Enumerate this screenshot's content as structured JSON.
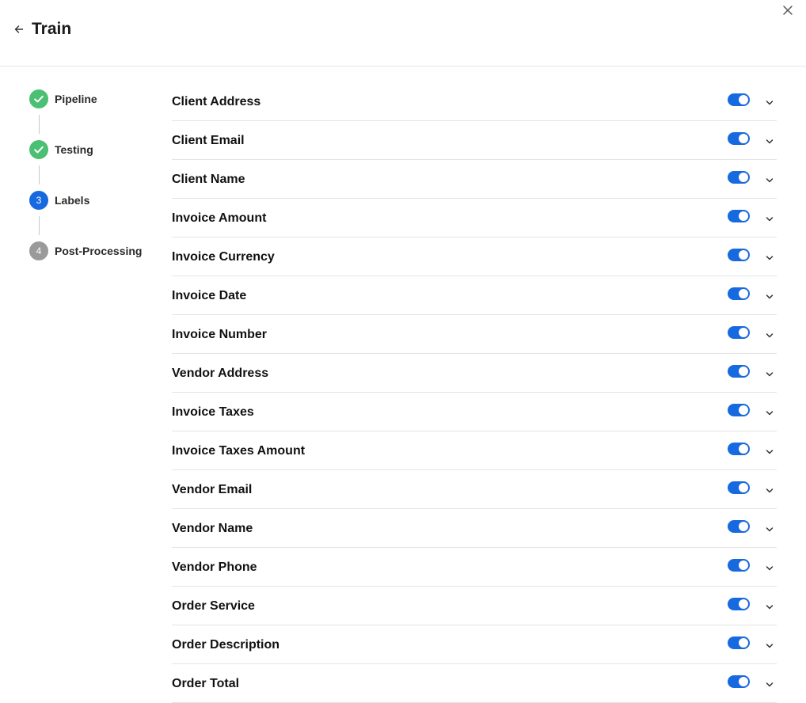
{
  "header": {
    "title": "Train",
    "icons": {
      "back": "arrow-left-icon",
      "close": "close-icon"
    }
  },
  "steps": [
    {
      "label": "Pipeline",
      "status": "done",
      "number": ""
    },
    {
      "label": "Testing",
      "status": "done",
      "number": ""
    },
    {
      "label": "Labels",
      "status": "active",
      "number": "3"
    },
    {
      "label": "Post-Processing",
      "status": "pending",
      "number": "4"
    }
  ],
  "labels": [
    {
      "name": "Client Address",
      "enabled": true
    },
    {
      "name": "Client Email",
      "enabled": true
    },
    {
      "name": "Client Name",
      "enabled": true
    },
    {
      "name": "Invoice Amount",
      "enabled": true
    },
    {
      "name": "Invoice Currency",
      "enabled": true
    },
    {
      "name": "Invoice Date",
      "enabled": true
    },
    {
      "name": "Invoice Number",
      "enabled": true
    },
    {
      "name": "Vendor Address",
      "enabled": true
    },
    {
      "name": "Invoice Taxes",
      "enabled": true
    },
    {
      "name": "Invoice Taxes Amount",
      "enabled": true
    },
    {
      "name": "Vendor Email",
      "enabled": true
    },
    {
      "name": "Vendor Name",
      "enabled": true
    },
    {
      "name": "Vendor Phone",
      "enabled": true
    },
    {
      "name": "Order Service",
      "enabled": true
    },
    {
      "name": "Order Description",
      "enabled": true
    },
    {
      "name": "Order Total",
      "enabled": true
    }
  ],
  "colors": {
    "accent": "#1769e0",
    "success": "#4bbf73",
    "pending": "#9a9a9a",
    "divider": "#e4e4e4"
  }
}
